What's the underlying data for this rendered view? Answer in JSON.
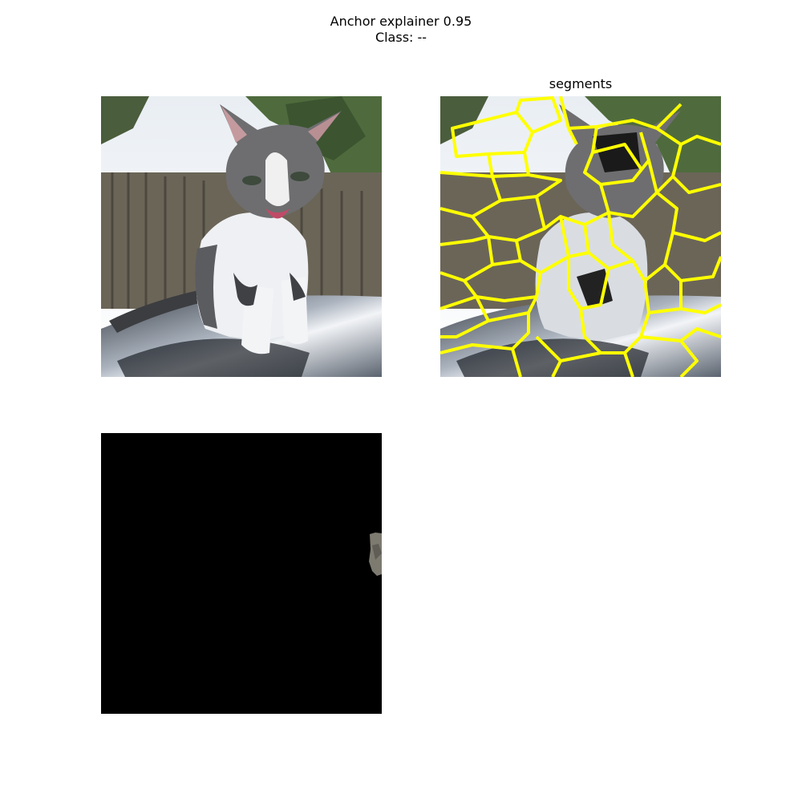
{
  "figure": {
    "title_line1": "Anchor explainer 0.95",
    "title_line2": "Class: --"
  },
  "panels": {
    "original": {
      "icon": "cat-photo"
    },
    "segments": {
      "title": "segments",
      "boundary_color": "#ffff00",
      "icon": "cat-photo-segmented"
    },
    "anchor": {
      "icon": "masked-anchor",
      "background": "#000000"
    }
  }
}
